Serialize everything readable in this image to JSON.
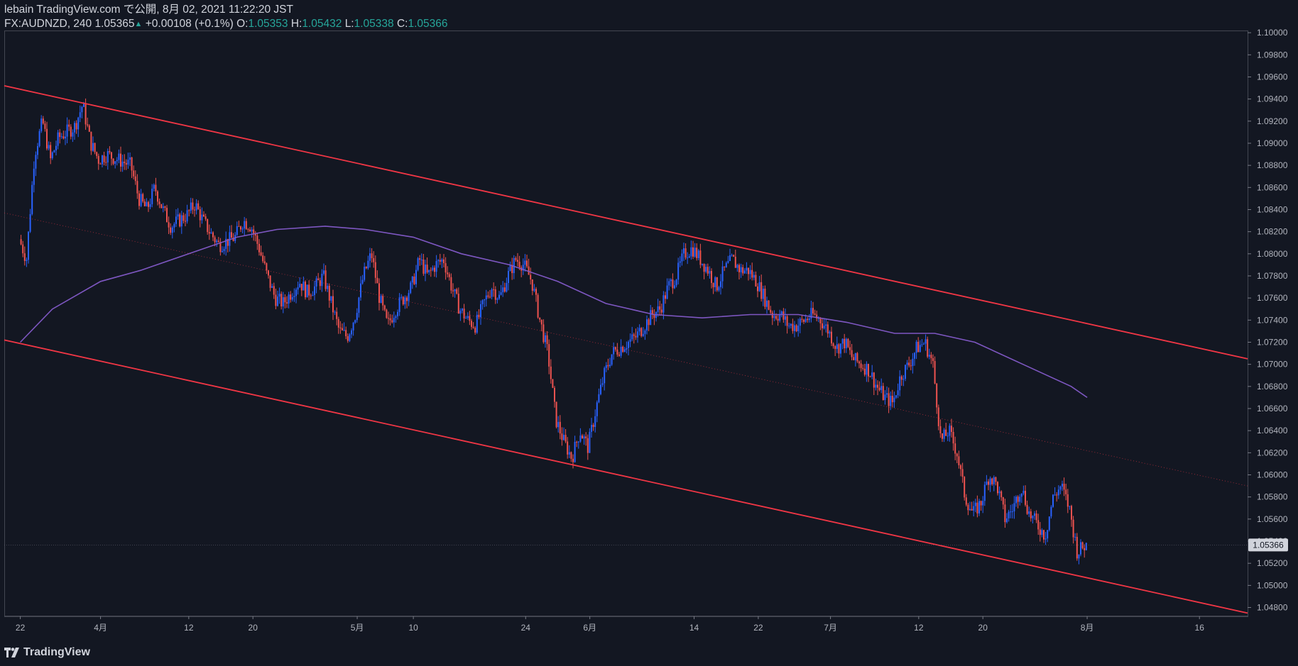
{
  "header": {
    "publish_line": "lebain TradingView.com で公開, 8月 02, 2021 11:22:20 JST",
    "symbol": "FX:AUDNZD, 240",
    "last": "1.05365",
    "change": "+0.00108 (+0.1%)",
    "o_label": "O:",
    "o_value": "1.05353",
    "h_label": "H:",
    "h_value": "1.05432",
    "l_label": "L:",
    "l_value": "1.05338",
    "c_label": "C:",
    "c_value": "1.05366"
  },
  "brand": "TradingView",
  "colors": {
    "background": "#131722",
    "candle_up": "#2962ff",
    "candle_down": "#ef5350",
    "channel": "#f23645",
    "moving_average": "#7e57c2",
    "price_label_bg": "#d1d4dc"
  },
  "chart_data": {
    "type": "candlestick",
    "instrument": "FX:AUDNZD",
    "timeframe": "240",
    "y_range": [
      1.0472,
      1.1002
    ],
    "y_ticks": [
      "1.10000",
      "1.09800",
      "1.09600",
      "1.09400",
      "1.09200",
      "1.09000",
      "1.08800",
      "1.08600",
      "1.08400",
      "1.08200",
      "1.08000",
      "1.07800",
      "1.07600",
      "1.07400",
      "1.07200",
      "1.07000",
      "1.06800",
      "1.06600",
      "1.06400",
      "1.06200",
      "1.06000",
      "1.05800",
      "1.05600",
      "1.05400",
      "1.05200",
      "1.05000",
      "1.04800"
    ],
    "x_ticks": [
      {
        "label": "22",
        "date": "2021-03-22"
      },
      {
        "label": "4月",
        "date": "2021-04-01"
      },
      {
        "label": "12",
        "date": "2021-04-12"
      },
      {
        "label": "20",
        "date": "2021-04-20"
      },
      {
        "label": "5月",
        "date": "2021-05-03"
      },
      {
        "label": "10",
        "date": "2021-05-10"
      },
      {
        "label": "24",
        "date": "2021-05-24"
      },
      {
        "label": "6月",
        "date": "2021-06-01"
      },
      {
        "label": "14",
        "date": "2021-06-14"
      },
      {
        "label": "22",
        "date": "2021-06-22"
      },
      {
        "label": "7月",
        "date": "2021-07-01"
      },
      {
        "label": "12",
        "date": "2021-07-12"
      },
      {
        "label": "20",
        "date": "2021-07-20"
      },
      {
        "label": "8月",
        "date": "2021-08-02"
      },
      {
        "label": "16",
        "date": "2021-08-16"
      }
    ],
    "current_price_label": "1.05366",
    "current_price": 1.05366,
    "price_path": [
      [
        "2021-03-22",
        1.0815
      ],
      [
        "2021-03-23",
        1.0795
      ],
      [
        "2021-03-24",
        1.089
      ],
      [
        "2021-03-25",
        1.092
      ],
      [
        "2021-03-26",
        1.0885
      ],
      [
        "2021-03-27",
        1.0905
      ],
      [
        "2021-03-29",
        1.0915
      ],
      [
        "2021-03-30",
        1.0935
      ],
      [
        "2021-03-31",
        1.09
      ],
      [
        "2021-04-01",
        1.0885
      ],
      [
        "2021-04-02",
        1.089
      ],
      [
        "2021-04-05",
        1.088
      ],
      [
        "2021-04-06",
        1.085
      ],
      [
        "2021-04-07",
        1.084
      ],
      [
        "2021-04-08",
        1.086
      ],
      [
        "2021-04-09",
        1.084
      ],
      [
        "2021-04-10",
        1.0825
      ],
      [
        "2021-04-12",
        1.0835
      ],
      [
        "2021-04-13",
        1.0845
      ],
      [
        "2021-04-14",
        1.083
      ],
      [
        "2021-04-15",
        1.0818
      ],
      [
        "2021-04-16",
        1.0808
      ],
      [
        "2021-04-18",
        1.0815
      ],
      [
        "2021-04-19",
        1.083
      ],
      [
        "2021-04-20",
        1.0825
      ],
      [
        "2021-04-21",
        1.0805
      ],
      [
        "2021-04-22",
        1.078
      ],
      [
        "2021-04-23",
        1.076
      ],
      [
        "2021-04-24",
        1.0755
      ],
      [
        "2021-04-26",
        1.0775
      ],
      [
        "2021-04-27",
        1.0765
      ],
      [
        "2021-04-28",
        1.077
      ],
      [
        "2021-04-29",
        1.078
      ],
      [
        "2021-04-30",
        1.0755
      ],
      [
        "2021-05-01",
        1.073
      ],
      [
        "2021-05-02",
        1.0725
      ],
      [
        "2021-05-03",
        1.0745
      ],
      [
        "2021-05-04",
        1.078
      ],
      [
        "2021-05-05",
        1.08
      ],
      [
        "2021-05-06",
        1.076
      ],
      [
        "2021-05-07",
        1.0735
      ],
      [
        "2021-05-08",
        1.075
      ],
      [
        "2021-05-10",
        1.077
      ],
      [
        "2021-05-11",
        1.0795
      ],
      [
        "2021-05-12",
        1.078
      ],
      [
        "2021-05-13",
        1.079
      ],
      [
        "2021-05-14",
        1.0795
      ],
      [
        "2021-05-15",
        1.077
      ],
      [
        "2021-05-16",
        1.075
      ],
      [
        "2021-05-17",
        1.074
      ],
      [
        "2021-05-18",
        1.0735
      ],
      [
        "2021-05-19",
        1.0755
      ],
      [
        "2021-05-20",
        1.077
      ],
      [
        "2021-05-21",
        1.076
      ],
      [
        "2021-05-22",
        1.078
      ],
      [
        "2021-05-23",
        1.0795
      ],
      [
        "2021-05-24",
        1.079
      ],
      [
        "2021-05-25",
        1.0775
      ],
      [
        "2021-05-26",
        1.074
      ],
      [
        "2021-05-27",
        1.071
      ],
      [
        "2021-05-28",
        1.065
      ],
      [
        "2021-05-29",
        1.063
      ],
      [
        "2021-05-30",
        1.0615
      ],
      [
        "2021-05-31",
        1.064
      ],
      [
        "2021-06-01",
        1.0625
      ],
      [
        "2021-06-02",
        1.066
      ],
      [
        "2021-06-03",
        1.069
      ],
      [
        "2021-06-04",
        1.071
      ],
      [
        "2021-06-05",
        1.0715
      ],
      [
        "2021-06-07",
        1.0725
      ],
      [
        "2021-06-08",
        1.0735
      ],
      [
        "2021-06-09",
        1.0745
      ],
      [
        "2021-06-10",
        1.075
      ],
      [
        "2021-06-11",
        1.077
      ],
      [
        "2021-06-12",
        1.078
      ],
      [
        "2021-06-13",
        1.08
      ],
      [
        "2021-06-14",
        1.0805
      ],
      [
        "2021-06-15",
        1.0795
      ],
      [
        "2021-06-16",
        1.0785
      ],
      [
        "2021-06-17",
        1.077
      ],
      [
        "2021-06-18",
        1.0785
      ],
      [
        "2021-06-19",
        1.0795
      ],
      [
        "2021-06-20",
        1.0785
      ],
      [
        "2021-06-21",
        1.0785
      ],
      [
        "2021-06-22",
        1.0775
      ],
      [
        "2021-06-23",
        1.076
      ],
      [
        "2021-06-24",
        1.0745
      ],
      [
        "2021-06-25",
        1.0745
      ],
      [
        "2021-06-26",
        1.0735
      ],
      [
        "2021-06-27",
        1.0735
      ],
      [
        "2021-06-28",
        1.074
      ],
      [
        "2021-06-29",
        1.0745
      ],
      [
        "2021-06-30",
        1.074
      ],
      [
        "2021-07-01",
        1.073
      ],
      [
        "2021-07-02",
        1.0715
      ],
      [
        "2021-07-03",
        1.072
      ],
      [
        "2021-07-04",
        1.0705
      ],
      [
        "2021-07-05",
        1.07
      ],
      [
        "2021-07-06",
        1.0695
      ],
      [
        "2021-07-07",
        1.068
      ],
      [
        "2021-07-08",
        1.067
      ],
      [
        "2021-07-09",
        1.0665
      ],
      [
        "2021-07-10",
        1.069
      ],
      [
        "2021-07-11",
        1.07
      ],
      [
        "2021-07-12",
        1.0715
      ],
      [
        "2021-07-13",
        1.072
      ],
      [
        "2021-07-14",
        1.07
      ],
      [
        "2021-07-15",
        1.063
      ],
      [
        "2021-07-16",
        1.064
      ],
      [
        "2021-07-17",
        1.062
      ],
      [
        "2021-07-18",
        1.058
      ],
      [
        "2021-07-19",
        1.0565
      ],
      [
        "2021-07-20",
        1.0575
      ],
      [
        "2021-07-21",
        1.06
      ],
      [
        "2021-07-22",
        1.059
      ],
      [
        "2021-07-23",
        1.056
      ],
      [
        "2021-07-24",
        1.057
      ],
      [
        "2021-07-25",
        1.059
      ],
      [
        "2021-07-26",
        1.0565
      ],
      [
        "2021-07-27",
        1.0555
      ],
      [
        "2021-07-28",
        1.0545
      ],
      [
        "2021-07-29",
        1.058
      ],
      [
        "2021-07-30",
        1.059
      ],
      [
        "2021-07-31",
        1.057
      ],
      [
        "2021-08-01",
        1.053
      ],
      [
        "2021-08-02",
        1.05366
      ]
    ],
    "moving_average": [
      [
        "2021-03-22",
        1.072
      ],
      [
        "2021-03-26",
        1.075
      ],
      [
        "2021-04-01",
        1.0775
      ],
      [
        "2021-04-06",
        1.0785
      ],
      [
        "2021-04-12",
        1.08
      ],
      [
        "2021-04-18",
        1.0815
      ],
      [
        "2021-04-23",
        1.0822
      ],
      [
        "2021-04-29",
        1.0825
      ],
      [
        "2021-05-04",
        1.0822
      ],
      [
        "2021-05-10",
        1.0815
      ],
      [
        "2021-05-16",
        1.08
      ],
      [
        "2021-05-22",
        1.079
      ],
      [
        "2021-05-28",
        1.0775
      ],
      [
        "2021-06-03",
        1.0755
      ],
      [
        "2021-06-09",
        1.0745
      ],
      [
        "2021-06-15",
        1.0742
      ],
      [
        "2021-06-21",
        1.0745
      ],
      [
        "2021-06-27",
        1.0745
      ],
      [
        "2021-07-03",
        1.0738
      ],
      [
        "2021-07-09",
        1.0728
      ],
      [
        "2021-07-14",
        1.0728
      ],
      [
        "2021-07-19",
        1.072
      ],
      [
        "2021-07-25",
        1.07
      ],
      [
        "2021-07-31",
        1.068
      ],
      [
        "2021-08-02",
        1.067
      ]
    ],
    "channel_upper": [
      [
        "2021-03-20",
        1.0952
      ],
      [
        "2021-08-22",
        1.0705
      ]
    ],
    "channel_lower": [
      [
        "2021-03-20",
        1.0722
      ],
      [
        "2021-08-22",
        1.0475
      ]
    ],
    "channel_middle": [
      [
        "2021-03-20",
        1.0837
      ],
      [
        "2021-08-22",
        1.059
      ]
    ],
    "grid": false,
    "legend": "none"
  }
}
